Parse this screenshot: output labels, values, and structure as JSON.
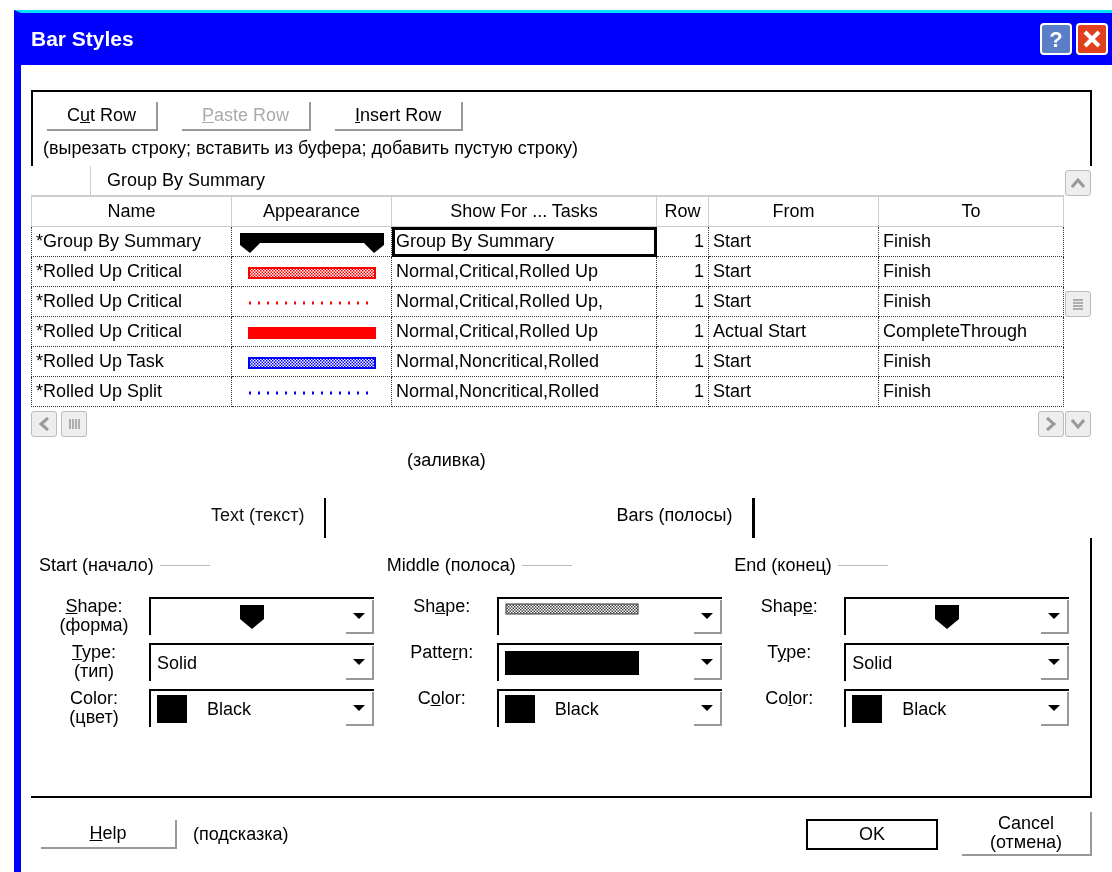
{
  "window": {
    "title": "Bar Styles",
    "title_buttons": [
      {
        "kind": "help",
        "label": "?"
      },
      {
        "kind": "close"
      }
    ]
  },
  "toolbar": {
    "buttons": [
      {
        "label_parts": {
          "pre": "C",
          "key": "u",
          "post": "t Row"
        },
        "disabled": false
      },
      {
        "label_parts": {
          "key": "P",
          "post": "aste Row"
        },
        "disabled": true
      },
      {
        "label_parts": {
          "key": "I",
          "post": "nsert Row"
        },
        "disabled": false
      }
    ],
    "hint": "(вырезать строку; вставить из буфера; добавить пустую строку)"
  },
  "table": {
    "entry": "Group By Summary",
    "columns": [
      "Name",
      "Appearance",
      "Show For ... Tasks",
      "Row",
      "From",
      "To"
    ],
    "rows": [
      {
        "name": "*Group By Summary",
        "appearance": {
          "kind": "summary",
          "color": "#000000"
        },
        "show_for": "Group By Summary",
        "row": "1",
        "from": "Start",
        "to": "Finish",
        "selected": true
      },
      {
        "name": "*Rolled Up Critical",
        "appearance": {
          "kind": "hatched",
          "color": "#ff0000"
        },
        "show_for": "Normal,Critical,Rolled Up",
        "row": "1",
        "from": "Start",
        "to": "Finish",
        "selected": false
      },
      {
        "name": "*Rolled Up Critical",
        "appearance": {
          "kind": "dotted",
          "color": "#ff0000"
        },
        "show_for": "Normal,Critical,Rolled Up,",
        "row": "1",
        "from": "Start",
        "to": "Finish",
        "selected": false
      },
      {
        "name": "*Rolled Up Critical",
        "appearance": {
          "kind": "solid",
          "color": "#ff0000"
        },
        "show_for": "Normal,Critical,Rolled Up",
        "row": "1",
        "from": "Actual Start",
        "to": "CompleteThrough",
        "selected": false
      },
      {
        "name": "*Rolled Up Task",
        "appearance": {
          "kind": "hatched",
          "color": "#0000ff"
        },
        "show_for": "Normal,Noncritical,Rolled",
        "row": "1",
        "from": "Start",
        "to": "Finish",
        "selected": false
      },
      {
        "name": "*Rolled Up Split",
        "appearance": {
          "kind": "dotted",
          "color": "#0000ff"
        },
        "show_for": "Normal,Noncritical,Rolled",
        "row": "1",
        "from": "Start",
        "to": "Finish",
        "selected": false
      }
    ]
  },
  "fill_note": "(заливка)",
  "tabs": [
    {
      "label": "Text (текст)",
      "selected": false
    },
    {
      "label": "Bars (полосы)",
      "selected": true
    }
  ],
  "groups": [
    {
      "title": "Start (начало)",
      "fields": [
        {
          "label_parts": {
            "key": "S",
            "post": "hape:"
          },
          "sublabel": "(форма)",
          "kind": "arrowhead"
        },
        {
          "label_parts": {
            "key": "T",
            "post": "ype:"
          },
          "sublabel": "(тип)",
          "kind": "text",
          "value": "Solid"
        },
        {
          "label_parts": {
            "pre": "Color:"
          },
          "sublabel": "(цвет)",
          "kind": "color",
          "color": "#000000",
          "value": "Black"
        }
      ]
    },
    {
      "title": "Middle (полоса)",
      "fields": [
        {
          "label_parts": {
            "pre": "Sh",
            "key": "a",
            "post": "pe:"
          },
          "kind": "hatched"
        },
        {
          "label_parts": {
            "pre": "Patte",
            "key": "r",
            "post": "n:"
          },
          "kind": "solidbar"
        },
        {
          "label_parts": {
            "pre": "C",
            "key": "o",
            "post": "lor:"
          },
          "kind": "color",
          "color": "#000000",
          "value": "Black"
        }
      ]
    },
    {
      "title": "End (конец)",
      "fields": [
        {
          "label_parts": {
            "pre": "Shap",
            "key": "e",
            "post": ":"
          },
          "kind": "arrowhead"
        },
        {
          "label_parts": {
            "pre": "T",
            "key": "y",
            "post": "pe:"
          },
          "kind": "text",
          "value": "Solid"
        },
        {
          "label_parts": {
            "pre": "Co",
            "key": "l",
            "post": "or:"
          },
          "kind": "color",
          "color": "#000000",
          "value": "Black"
        }
      ]
    }
  ],
  "footer": {
    "help": {
      "label_parts": {
        "key": "H",
        "post": "elp"
      }
    },
    "help_note": "(подсказка)",
    "ok": {
      "label": "OK",
      "default": true
    },
    "cancel": {
      "label": "Cancel",
      "note": "(отмена)"
    }
  }
}
